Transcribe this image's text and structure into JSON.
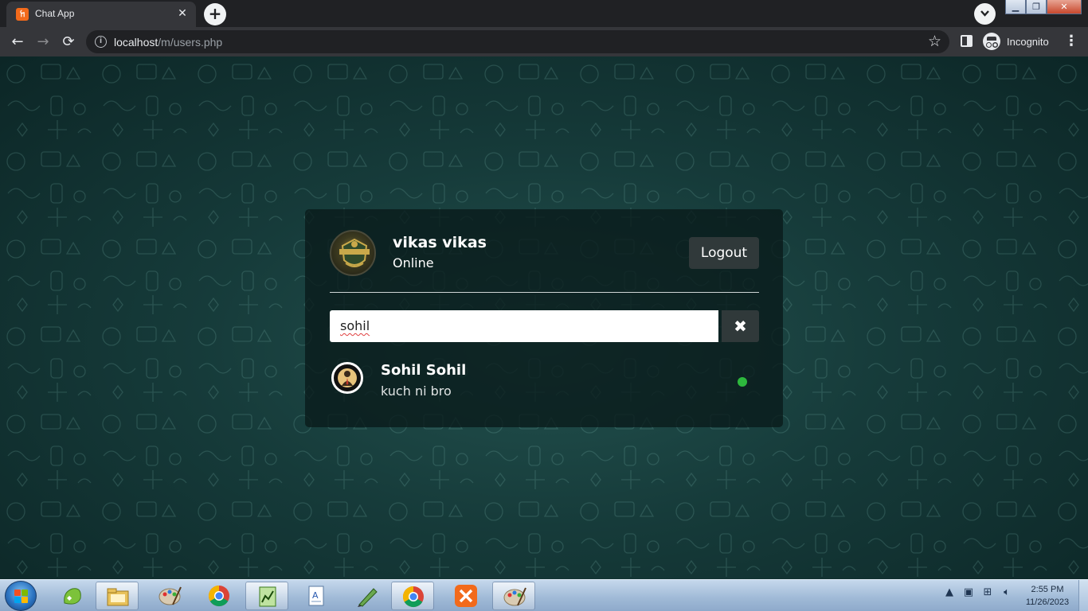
{
  "browser": {
    "tab_title": "Chat App",
    "tab_favicon": "xampp-icon",
    "tab_close": "✕",
    "new_tab": "+",
    "url_host": "localhost",
    "url_path": "/m/users.php",
    "profile_label": "Incognito"
  },
  "header": {
    "user_name": "vikas vikas",
    "user_status": "Online",
    "logout_label": "Logout"
  },
  "search": {
    "value": "sohil",
    "clear_symbol": "✖"
  },
  "users": [
    {
      "name": "Sohil Sohil",
      "last_message": "kuch ni bro",
      "status": "online"
    }
  ],
  "colors": {
    "online": "#2db83d",
    "card_bg": "#0a1b1b",
    "button_bg": "#30393a"
  },
  "taskbar": {
    "time": "2:55 PM",
    "date": "11/26/2023",
    "apps": [
      "start-button",
      "green-app-icon",
      "file-explorer-icon",
      "paint-icon",
      "chrome-icon",
      "spreadsheet-icon",
      "wordpad-icon",
      "pen-tool-icon",
      "chrome-icon",
      "xampp-icon",
      "paint-icon"
    ]
  }
}
